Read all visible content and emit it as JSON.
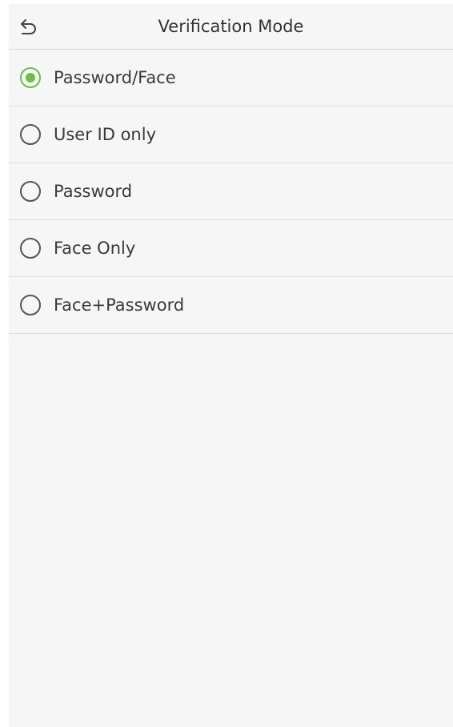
{
  "header": {
    "title": "Verification Mode",
    "back_icon": "back-arrow-icon"
  },
  "options": [
    {
      "label": "Password/Face",
      "selected": true
    },
    {
      "label": "User ID only",
      "selected": false
    },
    {
      "label": "Password",
      "selected": false
    },
    {
      "label": "Face Only",
      "selected": false
    },
    {
      "label": "Face+Password",
      "selected": false
    }
  ],
  "colors": {
    "accent": "#6cc04a",
    "background": "#f6f6f6",
    "divider": "#dcdcdc",
    "text": "#333333"
  }
}
